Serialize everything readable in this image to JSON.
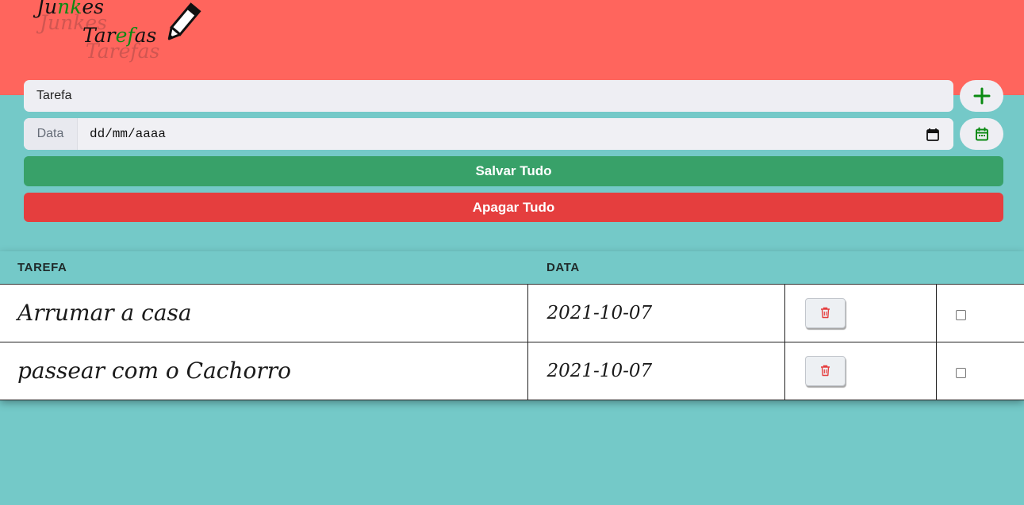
{
  "logo": {
    "line1_a": "Ju",
    "line1_b": "nk",
    "line1_c": "es",
    "line2_a": "Tar",
    "line2_b": "ef",
    "line2_c": "as",
    "shadow1": "Junkes",
    "shadow2": "Tarefas"
  },
  "form": {
    "task_placeholder": "Tarefa",
    "date_label": "Data",
    "date_value": "dd/mm/aaaa",
    "save_label": "Salvar Tudo",
    "clear_label": "Apagar Tudo"
  },
  "table": {
    "headers": [
      "TAREFA",
      "DATA"
    ],
    "rows": [
      {
        "task": "Arrumar a casa",
        "date": "2021-10-07",
        "checked": false
      },
      {
        "task": "passear com o Cachorro",
        "date": "2021-10-07",
        "checked": false
      }
    ]
  },
  "icons": {
    "add": "plus-icon",
    "calendar": "calendar-icon",
    "delete": "trash-icon",
    "logo": "pencil-icon",
    "date_picker": "calendar-picker-icon"
  },
  "colors": {
    "header": "#ff655d",
    "background": "#74c9c8",
    "save": "#38a169",
    "clear": "#e53e3e",
    "accent_green": "#0a8a12",
    "delete_icon": "#e53e3e"
  }
}
